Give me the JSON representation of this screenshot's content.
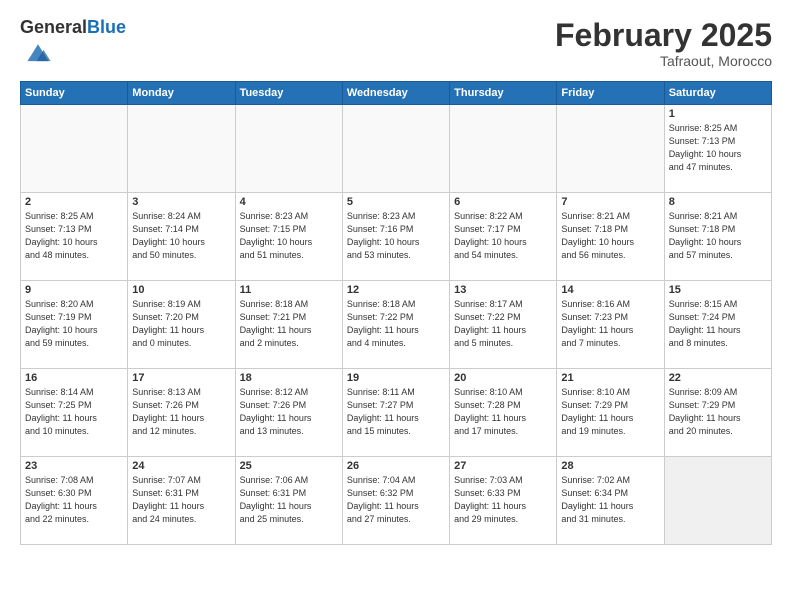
{
  "header": {
    "logo_general": "General",
    "logo_blue": "Blue",
    "month": "February 2025",
    "location": "Tafraout, Morocco"
  },
  "days_of_week": [
    "Sunday",
    "Monday",
    "Tuesday",
    "Wednesday",
    "Thursday",
    "Friday",
    "Saturday"
  ],
  "weeks": [
    [
      {
        "day": "",
        "info": ""
      },
      {
        "day": "",
        "info": ""
      },
      {
        "day": "",
        "info": ""
      },
      {
        "day": "",
        "info": ""
      },
      {
        "day": "",
        "info": ""
      },
      {
        "day": "",
        "info": ""
      },
      {
        "day": "1",
        "info": "Sunrise: 8:25 AM\nSunset: 7:13 PM\nDaylight: 10 hours\nand 47 minutes."
      }
    ],
    [
      {
        "day": "2",
        "info": "Sunrise: 8:25 AM\nSunset: 7:13 PM\nDaylight: 10 hours\nand 48 minutes."
      },
      {
        "day": "3",
        "info": "Sunrise: 8:24 AM\nSunset: 7:14 PM\nDaylight: 10 hours\nand 50 minutes."
      },
      {
        "day": "4",
        "info": "Sunrise: 8:23 AM\nSunset: 7:15 PM\nDaylight: 10 hours\nand 51 minutes."
      },
      {
        "day": "5",
        "info": "Sunrise: 8:23 AM\nSunset: 7:16 PM\nDaylight: 10 hours\nand 53 minutes."
      },
      {
        "day": "6",
        "info": "Sunrise: 8:22 AM\nSunset: 7:17 PM\nDaylight: 10 hours\nand 54 minutes."
      },
      {
        "day": "7",
        "info": "Sunrise: 8:21 AM\nSunset: 7:18 PM\nDaylight: 10 hours\nand 56 minutes."
      },
      {
        "day": "8",
        "info": "Sunrise: 8:21 AM\nSunset: 7:18 PM\nDaylight: 10 hours\nand 57 minutes."
      }
    ],
    [
      {
        "day": "9",
        "info": "Sunrise: 8:20 AM\nSunset: 7:19 PM\nDaylight: 10 hours\nand 59 minutes."
      },
      {
        "day": "10",
        "info": "Sunrise: 8:19 AM\nSunset: 7:20 PM\nDaylight: 11 hours\nand 0 minutes."
      },
      {
        "day": "11",
        "info": "Sunrise: 8:18 AM\nSunset: 7:21 PM\nDaylight: 11 hours\nand 2 minutes."
      },
      {
        "day": "12",
        "info": "Sunrise: 8:18 AM\nSunset: 7:22 PM\nDaylight: 11 hours\nand 4 minutes."
      },
      {
        "day": "13",
        "info": "Sunrise: 8:17 AM\nSunset: 7:22 PM\nDaylight: 11 hours\nand 5 minutes."
      },
      {
        "day": "14",
        "info": "Sunrise: 8:16 AM\nSunset: 7:23 PM\nDaylight: 11 hours\nand 7 minutes."
      },
      {
        "day": "15",
        "info": "Sunrise: 8:15 AM\nSunset: 7:24 PM\nDaylight: 11 hours\nand 8 minutes."
      }
    ],
    [
      {
        "day": "16",
        "info": "Sunrise: 8:14 AM\nSunset: 7:25 PM\nDaylight: 11 hours\nand 10 minutes."
      },
      {
        "day": "17",
        "info": "Sunrise: 8:13 AM\nSunset: 7:26 PM\nDaylight: 11 hours\nand 12 minutes."
      },
      {
        "day": "18",
        "info": "Sunrise: 8:12 AM\nSunset: 7:26 PM\nDaylight: 11 hours\nand 13 minutes."
      },
      {
        "day": "19",
        "info": "Sunrise: 8:11 AM\nSunset: 7:27 PM\nDaylight: 11 hours\nand 15 minutes."
      },
      {
        "day": "20",
        "info": "Sunrise: 8:10 AM\nSunset: 7:28 PM\nDaylight: 11 hours\nand 17 minutes."
      },
      {
        "day": "21",
        "info": "Sunrise: 8:10 AM\nSunset: 7:29 PM\nDaylight: 11 hours\nand 19 minutes."
      },
      {
        "day": "22",
        "info": "Sunrise: 8:09 AM\nSunset: 7:29 PM\nDaylight: 11 hours\nand 20 minutes."
      }
    ],
    [
      {
        "day": "23",
        "info": "Sunrise: 7:08 AM\nSunset: 6:30 PM\nDaylight: 11 hours\nand 22 minutes."
      },
      {
        "day": "24",
        "info": "Sunrise: 7:07 AM\nSunset: 6:31 PM\nDaylight: 11 hours\nand 24 minutes."
      },
      {
        "day": "25",
        "info": "Sunrise: 7:06 AM\nSunset: 6:31 PM\nDaylight: 11 hours\nand 25 minutes."
      },
      {
        "day": "26",
        "info": "Sunrise: 7:04 AM\nSunset: 6:32 PM\nDaylight: 11 hours\nand 27 minutes."
      },
      {
        "day": "27",
        "info": "Sunrise: 7:03 AM\nSunset: 6:33 PM\nDaylight: 11 hours\nand 29 minutes."
      },
      {
        "day": "28",
        "info": "Sunrise: 7:02 AM\nSunset: 6:34 PM\nDaylight: 11 hours\nand 31 minutes."
      },
      {
        "day": "",
        "info": ""
      }
    ]
  ]
}
